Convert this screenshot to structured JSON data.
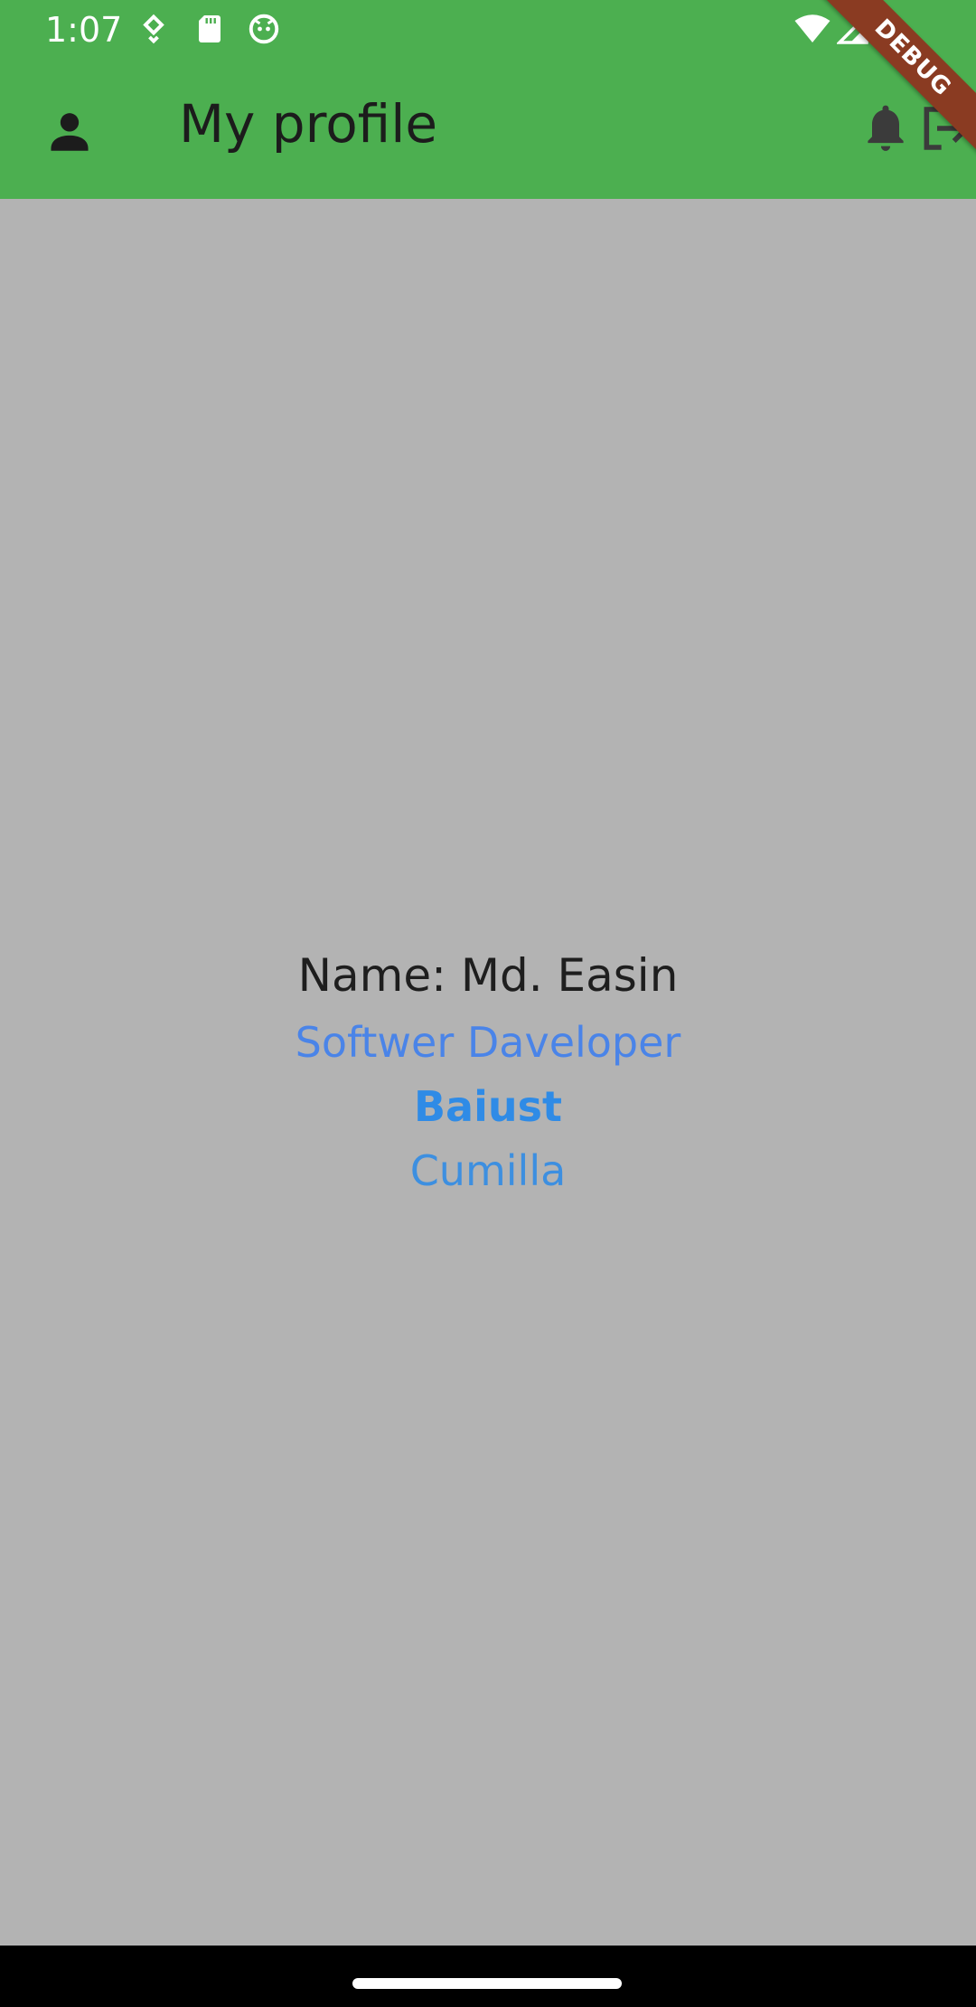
{
  "status_bar": {
    "time": "1:07",
    "icons": [
      "location-icon",
      "sd-card-icon",
      "cat-face-icon",
      "wifi-icon",
      "signal-icon"
    ]
  },
  "app_bar": {
    "title": "My profile",
    "leading_icon": "person-icon",
    "actions": [
      "notification-bell-icon",
      "logout-icon"
    ],
    "background_color": "#4CAF50"
  },
  "debug_banner": {
    "label": "DEBUG"
  },
  "profile": {
    "name": "Name: Md. Easin",
    "role": "Softwer Daveloper",
    "organization": "Baiust",
    "city": "Cumilla"
  },
  "colors": {
    "content_background": "#B3B3B3",
    "accent_blue": "#2F8BE6"
  }
}
